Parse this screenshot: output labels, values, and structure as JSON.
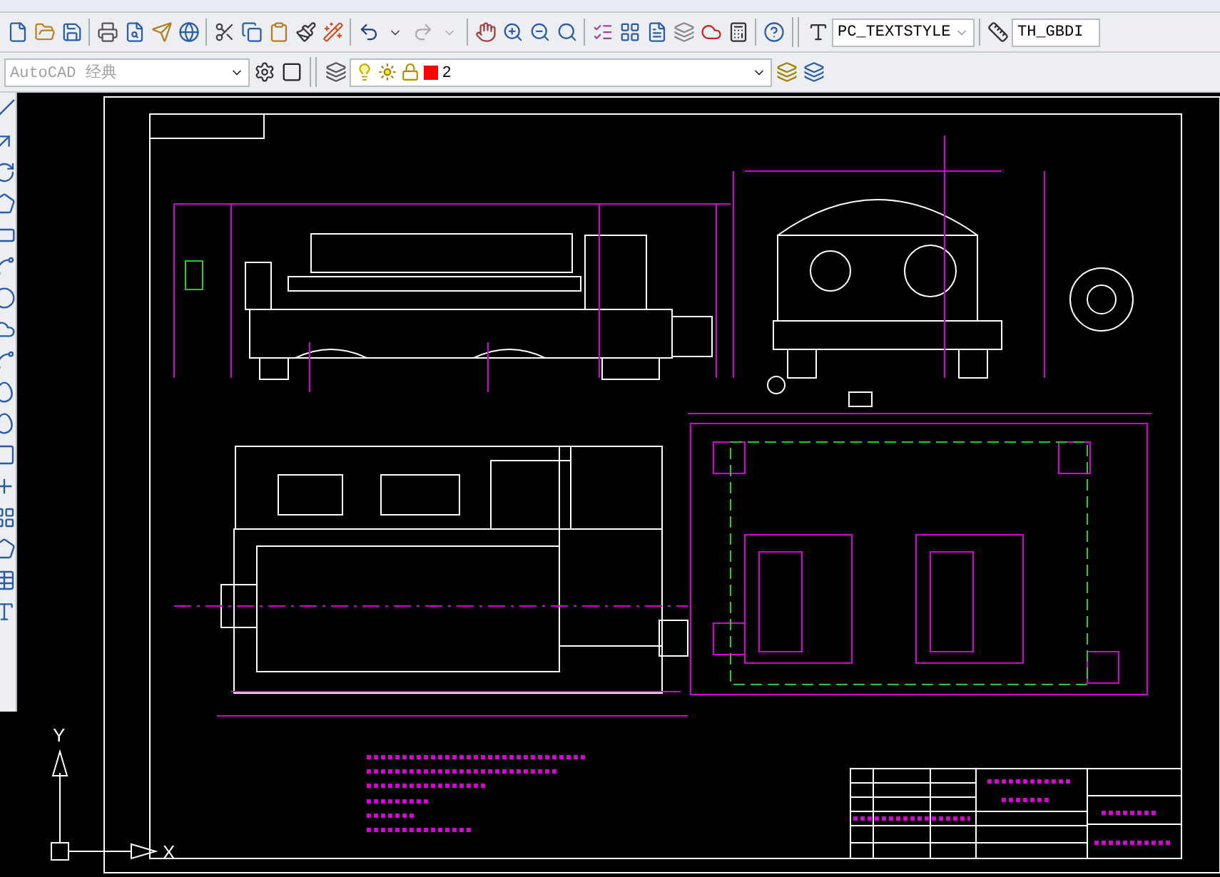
{
  "workspace": {
    "value": "AutoCAD 经典"
  },
  "layer": {
    "name": "2",
    "on": true,
    "color": "#ff0000"
  },
  "text_style": {
    "value": "PC_TEXTSTYLE"
  },
  "dim_style": {
    "value": "TH_GBDI"
  },
  "ucs": {
    "y_label": "Y",
    "x_label": "X"
  }
}
